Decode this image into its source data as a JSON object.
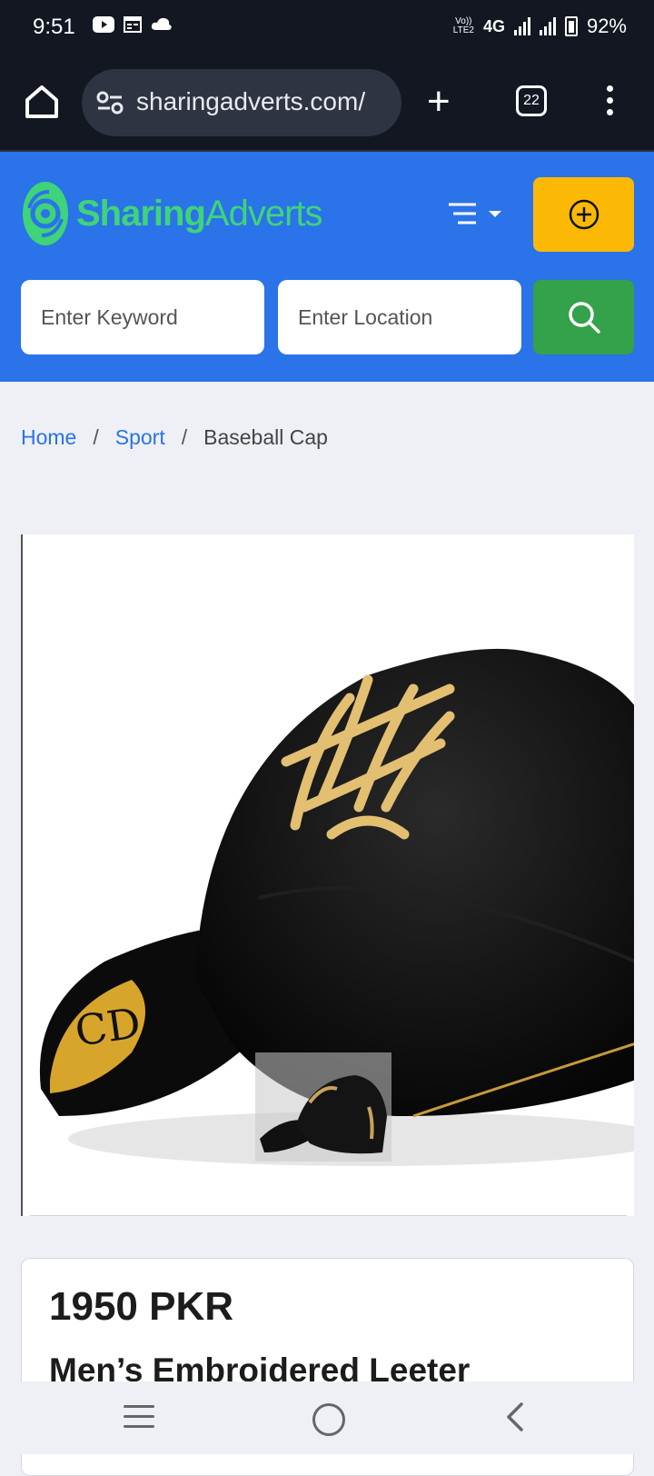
{
  "status_bar": {
    "time": "9:51",
    "network_badge_top": "Vo))",
    "network_badge_bottom": "LTE2",
    "network": "4G",
    "battery": "92%",
    "icons": [
      "youtube-icon",
      "calendar-icon",
      "cloud-icon",
      "signal-icon",
      "battery-icon"
    ]
  },
  "browser": {
    "url": "sharingadverts.com/",
    "tab_count": "22",
    "new_tab_label": "+"
  },
  "header": {
    "logo_part1": "Sharing",
    "logo_part2": "Adverts",
    "brand_color": "#2a73e8",
    "post_button_color": "#fbb906",
    "search_button_color": "#34a24a"
  },
  "search": {
    "keyword_placeholder": "Enter Keyword",
    "location_placeholder": "Enter Location"
  },
  "breadcrumb": {
    "home": "Home",
    "separator": "/",
    "category": "Sport",
    "current": "Baseball Cap"
  },
  "product": {
    "price": "1950 PKR",
    "title": "Men’s Embroidered Leeter"
  }
}
